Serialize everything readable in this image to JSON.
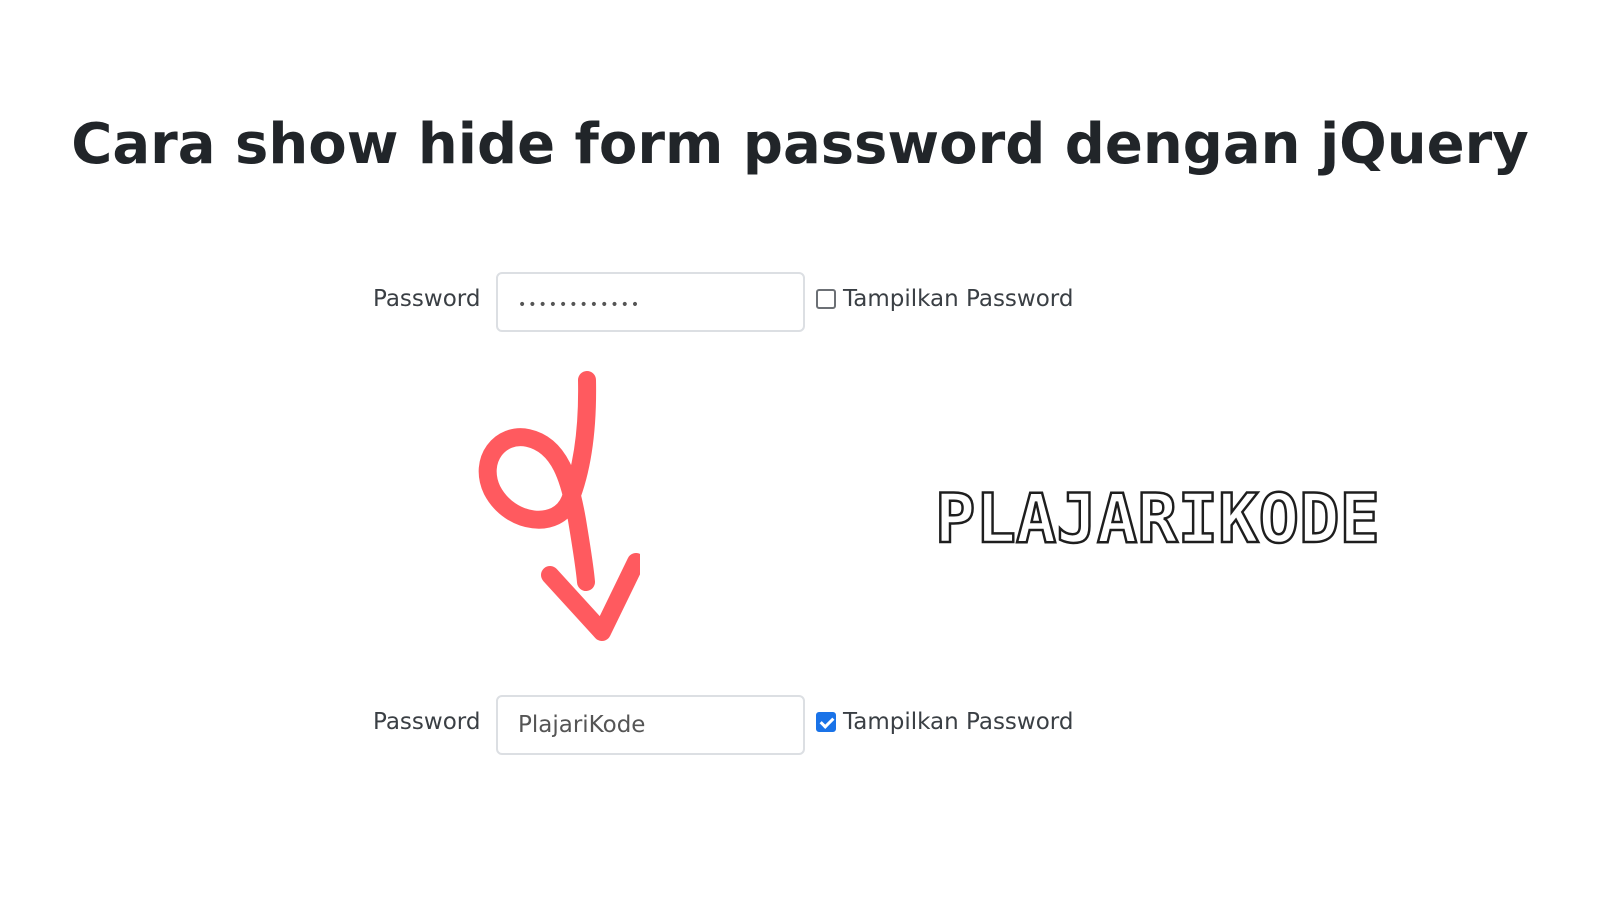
{
  "page": {
    "title": "Cara show hide form password dengan jQuery"
  },
  "form_hidden": {
    "label": "Password",
    "value": "••••••••••••",
    "checkbox_label": "Tampilkan Password",
    "checked": false
  },
  "form_shown": {
    "label": "Password",
    "value": "PlajariKode",
    "checkbox_label": "Tampilkan Password",
    "checked": true
  },
  "annotation": {
    "icon": "curly-arrow-down-icon",
    "color": "#ff5a5f"
  },
  "brand": {
    "logo_text": "PLAJARIKODE"
  },
  "colors": {
    "checkbox_checked": "#1a73e8",
    "title": "#212529"
  }
}
